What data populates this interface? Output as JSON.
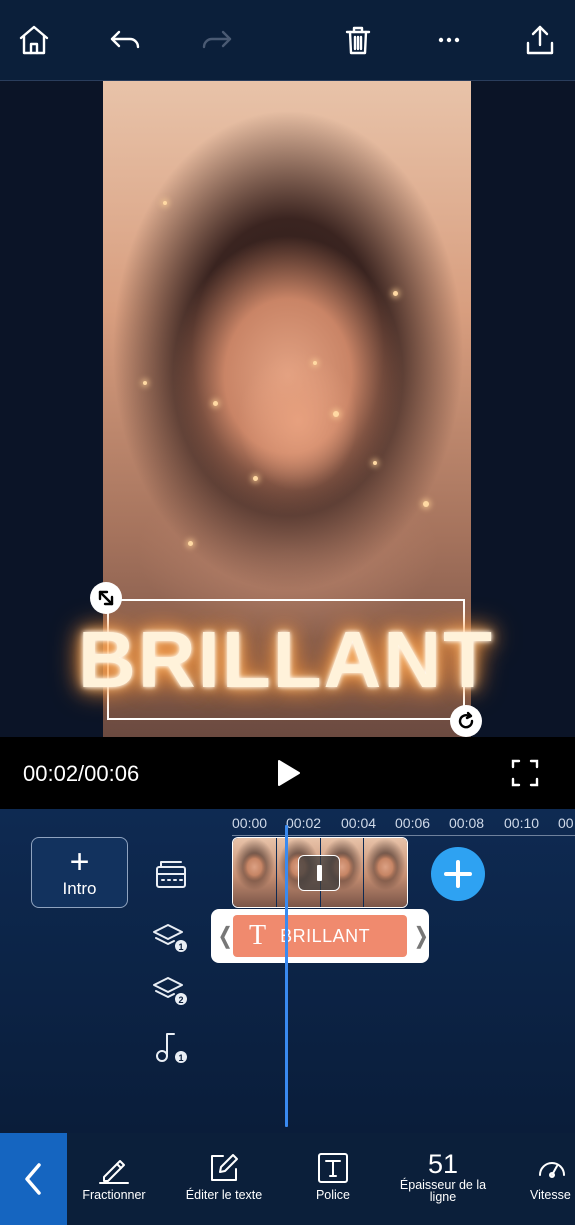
{
  "topbar": {
    "home_icon": "home-icon",
    "undo_icon": "undo-icon",
    "redo_icon": "redo-icon",
    "delete_icon": "trash-icon",
    "more_icon": "more-icon",
    "share_icon": "share-icon"
  },
  "preview": {
    "overlay_text": "BRILLANT"
  },
  "playback": {
    "timecode": "00:02/00:06"
  },
  "timeline": {
    "ticks": [
      "00:00",
      "00:02",
      "00:04",
      "00:06",
      "00:08",
      "00:10",
      "00"
    ],
    "intro_plus": "+",
    "intro_label": "Intro",
    "text_clip_icon": "T",
    "text_clip_label": "BRILLANT",
    "left_arrow": "❬",
    "right_arrow": "❭"
  },
  "toolbar": {
    "items": [
      {
        "label": "Fractionner",
        "icon": "split-pen-icon"
      },
      {
        "label": "Éditer le texte",
        "icon": "edit-text-icon"
      },
      {
        "label": "Police",
        "icon": "font-icon"
      },
      {
        "label": "Épaisseur de la ligne",
        "value": "51"
      },
      {
        "label": "Vitesse",
        "icon": "speed-icon"
      }
    ]
  },
  "colors": {
    "accent": "#2ea2f2",
    "back_button": "#1565c0",
    "text_clip": "#f08a6e",
    "playhead": "#3a8af0"
  }
}
